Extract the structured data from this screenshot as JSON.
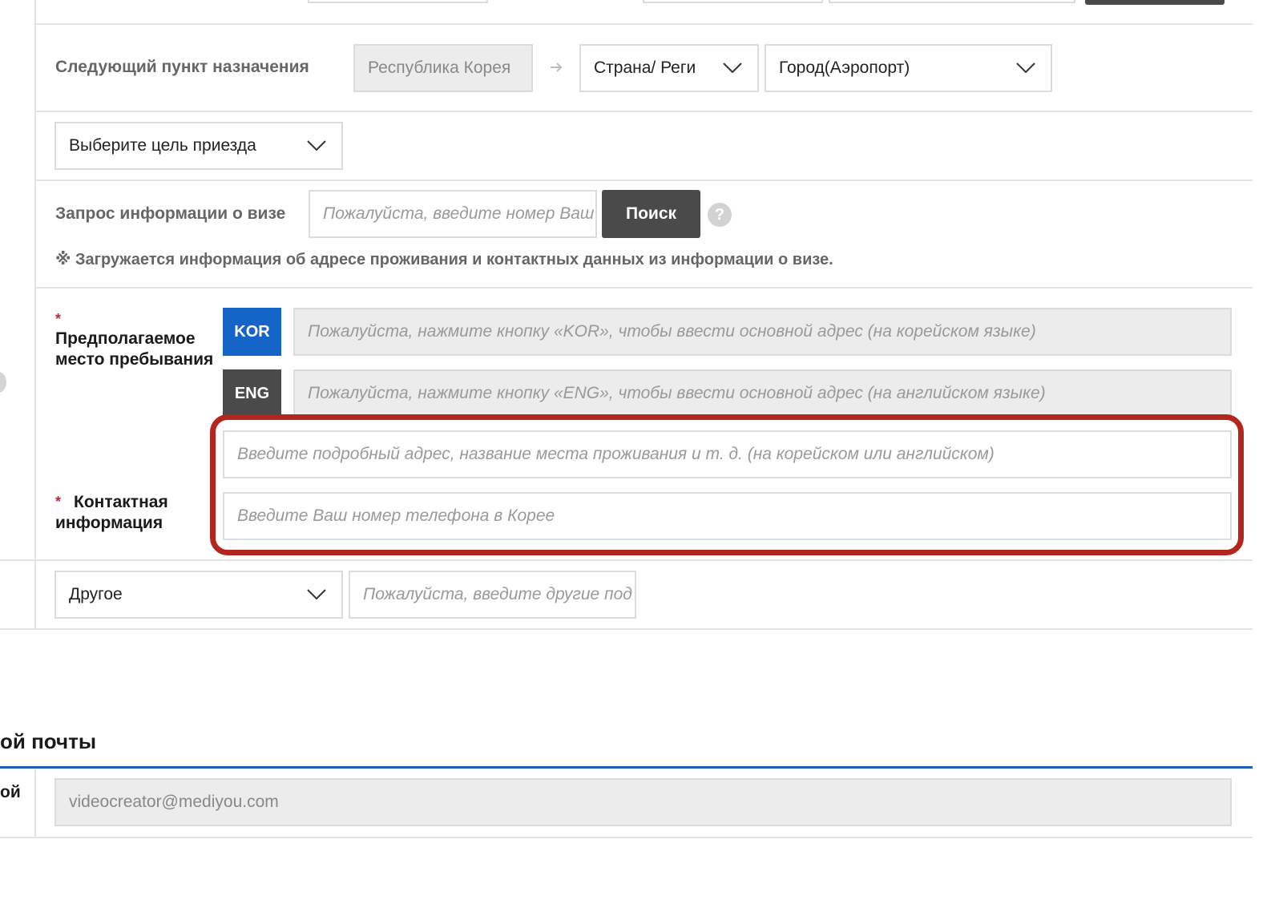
{
  "next_destination": {
    "label": "Следующий пункт назначения",
    "country_value": "Республика Корея",
    "country_region_select": "Страна/ Реги",
    "city_airport_select": "Город(Аэропорт)"
  },
  "purpose": {
    "select_value": "Выберите цель приезда"
  },
  "visa_inquiry": {
    "label": "Запрос информации о визе",
    "input_placeholder": "Пожалуйста, введите номер Ваш",
    "search_button": "Поиск",
    "help_icon_text": "?",
    "notice": "※ Загружается информация об адресе проживания и контактных данных из информации о визе."
  },
  "stay_address": {
    "required_mark": "*",
    "label": "Предполагаемое место пребывания",
    "kor_button": "KOR",
    "eng_button": "ENG",
    "kor_placeholder": "Пожалуйста, нажмите кнопку «KOR», чтобы ввести основной адрес (на корейском языке)",
    "eng_placeholder": "Пожалуйста, нажмите кнопку «ENG», чтобы ввести основной адрес (на английском языке)",
    "detail_placeholder": "Введите подробный адрес, название места проживания и т. д. (на корейском или английском)"
  },
  "contact": {
    "required_mark": "*",
    "label": "Контактная информация",
    "phone_placeholder": "Введите Ваш номер телефона в Корее"
  },
  "other": {
    "select_value": "Другое",
    "input_placeholder": "Пожалуйста, введите другие под"
  },
  "email_section": {
    "heading_fragment": "ой почты",
    "row_label_fragment": "ой",
    "email_value": "videocreator@mediyou.com"
  },
  "colors": {
    "kor_button": "#1565c8",
    "eng_button": "#4a4a4a",
    "search_button": "#4a4a4a",
    "highlight_outline": "#b3261e",
    "section_underline": "#1e5fb5"
  },
  "icons": [
    "arrow-right-icon",
    "chevron-down-icon",
    "help-icon"
  ]
}
